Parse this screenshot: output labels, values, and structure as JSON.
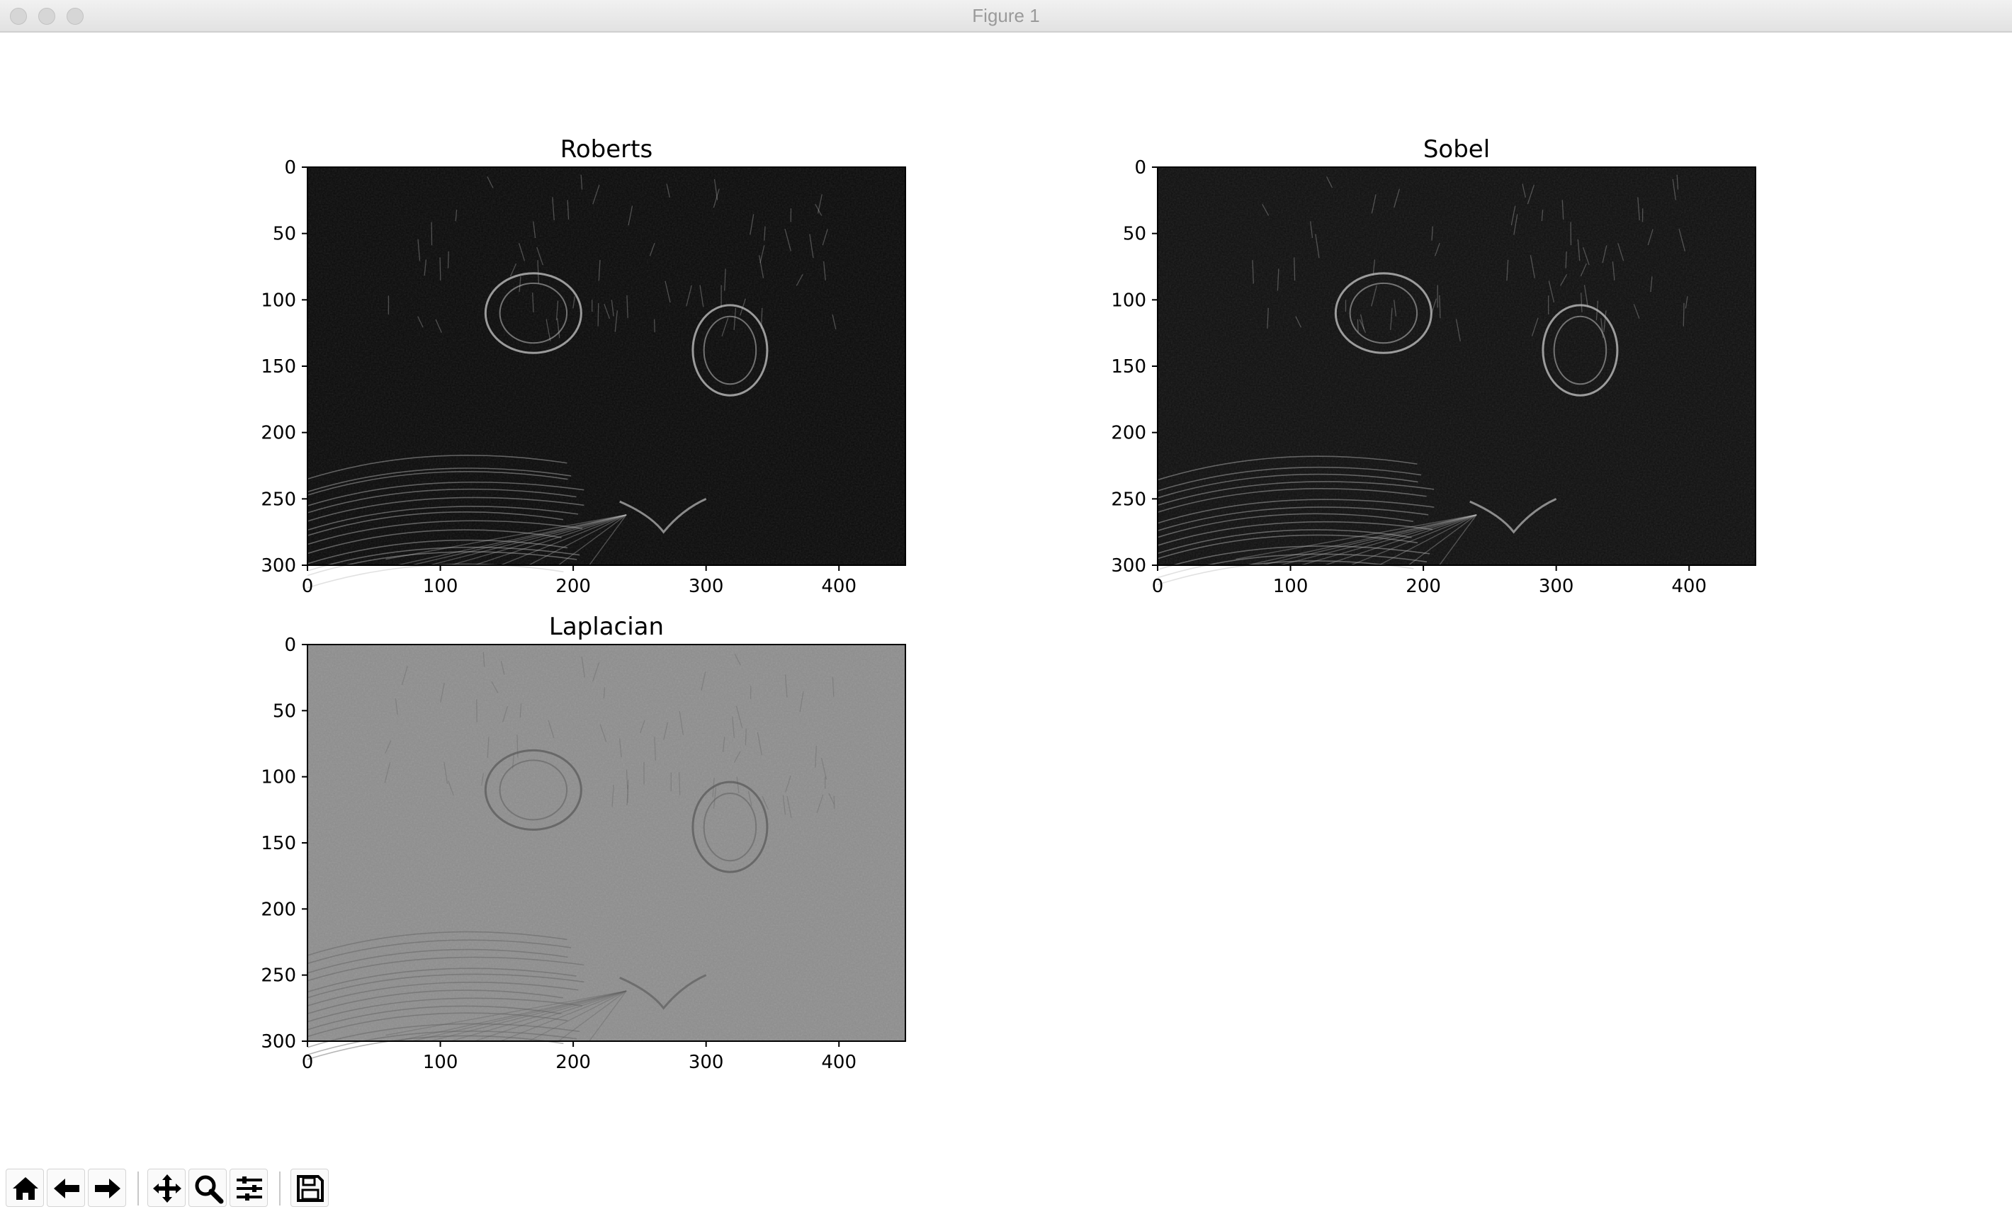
{
  "window": {
    "title": "Figure 1"
  },
  "toolbar": {
    "icons": [
      "home-icon",
      "back-arrow-icon",
      "forward-arrow-icon",
      "pan-icon",
      "zoom-icon",
      "configure-subplots-icon",
      "save-icon"
    ]
  },
  "chart_data": [
    {
      "type": "image",
      "title": "Roberts",
      "xlim": [
        0,
        450
      ],
      "ylim": [
        300,
        0
      ],
      "xticks": [
        "0",
        "100",
        "200",
        "300",
        "400"
      ],
      "yticks": [
        "0",
        "50",
        "100",
        "150",
        "200",
        "250",
        "300"
      ],
      "colormap": "gray",
      "background_color": "#0b0b0b"
    },
    {
      "type": "image",
      "title": "Sobel",
      "xlim": [
        0,
        450
      ],
      "ylim": [
        300,
        0
      ],
      "xticks": [
        "0",
        "100",
        "200",
        "300",
        "400"
      ],
      "yticks": [
        "0",
        "50",
        "100",
        "150",
        "200",
        "250",
        "300"
      ],
      "colormap": "gray",
      "background_color": "#101010"
    },
    {
      "type": "image",
      "title": "Laplacian",
      "xlim": [
        0,
        450
      ],
      "ylim": [
        300,
        0
      ],
      "xticks": [
        "0",
        "100",
        "200",
        "300",
        "400"
      ],
      "yticks": [
        "0",
        "50",
        "100",
        "150",
        "200",
        "250",
        "300"
      ],
      "colormap": "gray",
      "background_color": "#8e8e8e"
    }
  ]
}
